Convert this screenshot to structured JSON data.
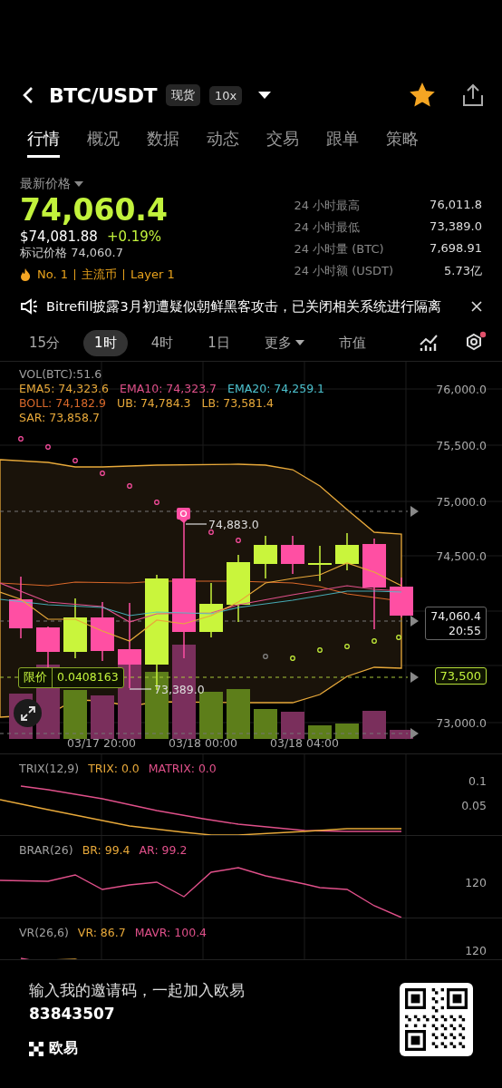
{
  "header": {
    "title": "BTC/USDT",
    "badges": [
      "现货",
      "10x"
    ],
    "favorite": true
  },
  "tabs": [
    {
      "label": "行情",
      "selected": true
    },
    {
      "label": "概况",
      "selected": false
    },
    {
      "label": "数据",
      "selected": false
    },
    {
      "label": "动态",
      "selected": false
    },
    {
      "label": "交易",
      "selected": false
    },
    {
      "label": "跟单",
      "selected": false
    },
    {
      "label": "策略",
      "selected": false
    }
  ],
  "price": {
    "label": "最新价格",
    "last": "74,060.4",
    "usd": "$74,081.88",
    "change": "+0.19%",
    "mark": "标记价格 74,060.7",
    "tags": [
      "No. 1",
      "主流币",
      "Layer 1"
    ]
  },
  "stats": [
    {
      "label": "24 小时最高",
      "value": "76,011.8"
    },
    {
      "label": "24 小时最低",
      "value": "73,389.0"
    },
    {
      "label": "24 小时量 (BTC)",
      "value": "7,698.91"
    },
    {
      "label": "24 小时额 (USDT)",
      "value": "5.73亿"
    }
  ],
  "news": {
    "text": "Bitrefill披露3月初遭疑似朝鲜黑客攻击，已关闭相关系统进行隔离"
  },
  "timeframes": [
    {
      "label": "15分",
      "kind": "plain",
      "selected": false
    },
    {
      "label": "1时",
      "kind": "plain",
      "selected": true
    },
    {
      "label": "4时",
      "kind": "plain",
      "selected": false
    },
    {
      "label": "1日",
      "kind": "plain",
      "selected": false
    },
    {
      "label": "更多",
      "kind": "menu",
      "selected": false
    },
    {
      "label": "市值",
      "kind": "plain",
      "selected": false
    }
  ],
  "chart": {
    "legend": [
      [
        {
          "text": "VOL(BTC):51.6",
          "color": "#a0a0a0"
        }
      ],
      [
        {
          "text": "EMA5: 74,323.6",
          "color": "#e8a93a"
        },
        {
          "text": "EMA10: 74,323.7",
          "color": "#e0508a"
        },
        {
          "text": "EMA20: 74,259.1",
          "color": "#4cc3d0"
        }
      ],
      [
        {
          "text": "BOLL: 74,182.9",
          "color": "#d9682a"
        },
        {
          "text": "UB: 74,784.3",
          "color": "#e8a93a"
        },
        {
          "text": "LB: 73,581.4",
          "color": "#e8a93a"
        }
      ],
      [
        {
          "text": "SAR: 73,858.7",
          "color": "#e8a93a"
        }
      ]
    ],
    "price_axis": [
      "76,000.0",
      "75,500.0",
      "75,000.0",
      "74,500.0",
      "73,000.0"
    ],
    "time_axis": [
      "03/17 20:00",
      "03/18 00:00",
      "03/18 04:00"
    ],
    "high_label": "74,883.0",
    "low_label": "73,389.0",
    "last_price": "74,060.4",
    "countdown": "20:55",
    "limit_order": {
      "label": "限价",
      "value": "0.0408163"
    },
    "alert_price": "73,500"
  },
  "indicators": [
    {
      "title": [
        {
          "text": "TRIX(12,9)",
          "color": "#a0a0a0"
        },
        {
          "text": "TRIX: 0.0",
          "color": "#e8a93a"
        },
        {
          "text": "MATRIX: 0.0",
          "color": "#e0508a"
        }
      ],
      "axis": [
        "0.1",
        "0.05"
      ]
    },
    {
      "title": [
        {
          "text": "BRAR(26)",
          "color": "#a0a0a0"
        },
        {
          "text": "BR: 99.4",
          "color": "#e8a93a"
        },
        {
          "text": "AR: 99.2",
          "color": "#e0508a"
        }
      ],
      "axis": [
        "120"
      ]
    },
    {
      "title": [
        {
          "text": "VR(26,6)",
          "color": "#a0a0a0"
        },
        {
          "text": "VR: 86.7",
          "color": "#e8a93a"
        },
        {
          "text": "MAVR: 100.4",
          "color": "#e0508a"
        }
      ],
      "axis": [
        "120"
      ]
    }
  ],
  "footer": {
    "invite": "输入我的邀请码，一起加入欧易",
    "code": "83843507",
    "brand": "欧易"
  }
}
